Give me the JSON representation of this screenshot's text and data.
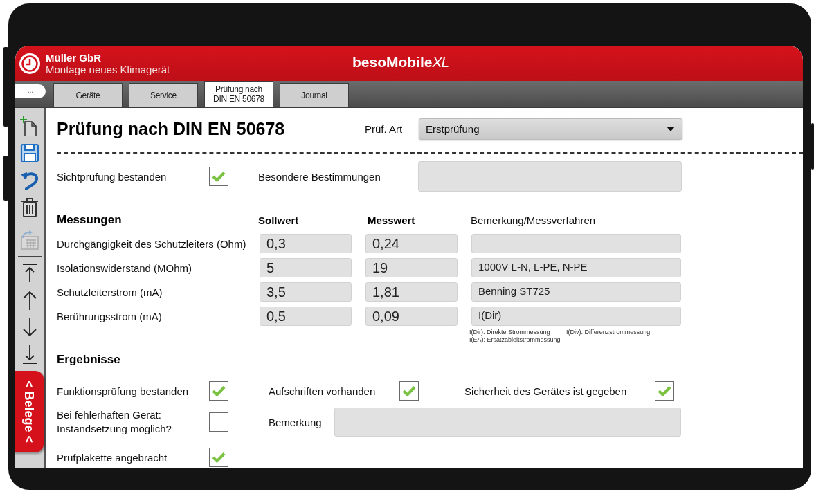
{
  "header": {
    "company": "Müller GbR",
    "job": "Montage neues Klimagerät",
    "app_name": "besoMobile",
    "app_edition": "XL"
  },
  "menu_button": {
    "label": "..."
  },
  "tabs": [
    {
      "label": "Geräte",
      "selected": false
    },
    {
      "label": "Service",
      "selected": false
    },
    {
      "label": "Prüfung nach\nDIN EN 50678",
      "selected": true
    },
    {
      "label": "Journal",
      "selected": false
    }
  ],
  "sidebar": {
    "tool_groups": [
      {
        "tools": [
          {
            "kind": "new",
            "disabled": false
          },
          {
            "kind": "save",
            "disabled": false
          },
          {
            "kind": "undo",
            "disabled": false
          },
          {
            "kind": "delete",
            "disabled": false
          }
        ]
      },
      {
        "tools": [
          {
            "kind": "export",
            "disabled": true
          }
        ]
      },
      {
        "tools": [
          {
            "kind": "first",
            "disabled": false
          },
          {
            "kind": "up",
            "disabled": false
          },
          {
            "kind": "down",
            "disabled": false
          },
          {
            "kind": "last",
            "disabled": false
          }
        ]
      }
    ],
    "belege_tab": {
      "label": "< Belege <"
    }
  },
  "form": {
    "title": "Prüfung nach DIN EN 50678",
    "test_type": {
      "label": "Prüf. Art",
      "value": "Erstprüfung"
    },
    "visual_check": {
      "label": "Sichtprüfung bestanden",
      "checked": true
    },
    "special_rules": {
      "label": "Besondere Bestimmungen"
    },
    "measurements": {
      "heading": "Messungen",
      "columns": [
        "Sollwert",
        "Messwert",
        "Bemerkung/Messverfahren"
      ],
      "rows": [
        {
          "name": "Durchgängigkeit des Schutzleiters (Ohm)",
          "target": "0,3",
          "measured": "0,24"
        },
        {
          "name": "Isolationswiderstand (MOhm)",
          "target": "5",
          "measured": "19",
          "remark": "1000V L-N, L-PE, N-PE"
        },
        {
          "name": "Schutzleiterstrom (mA)",
          "target": "3,5",
          "measured": "1,81",
          "remark": "Benning ST725"
        },
        {
          "name": "Berührungsstrom (mA)",
          "target": "0,5",
          "measured": "0,09",
          "remark": "I(Dir)"
        }
      ],
      "legend": [
        "I(Dir): Direkte Strommessung",
        "I(Div): Differenzstrommessung",
        "I(EA): Ersatzableitstrommessung"
      ]
    },
    "results": {
      "heading": "Ergebnisse",
      "checks": [
        {
          "label": "Funktionsprüfung bestanden",
          "checked": true
        },
        {
          "label": "Aufschriften vorhanden",
          "checked": true
        },
        {
          "label": "Sicherheit des Gerätes ist gegeben",
          "checked": true
        }
      ],
      "repair": {
        "label": "Bei fehlerhaften Gerät:\nInstandsetzung möglich?",
        "checked": false
      },
      "remark": {
        "label": "Bemerkung"
      },
      "sticker": {
        "label": "Prüfplakette angebracht",
        "checked": true
      }
    }
  }
}
